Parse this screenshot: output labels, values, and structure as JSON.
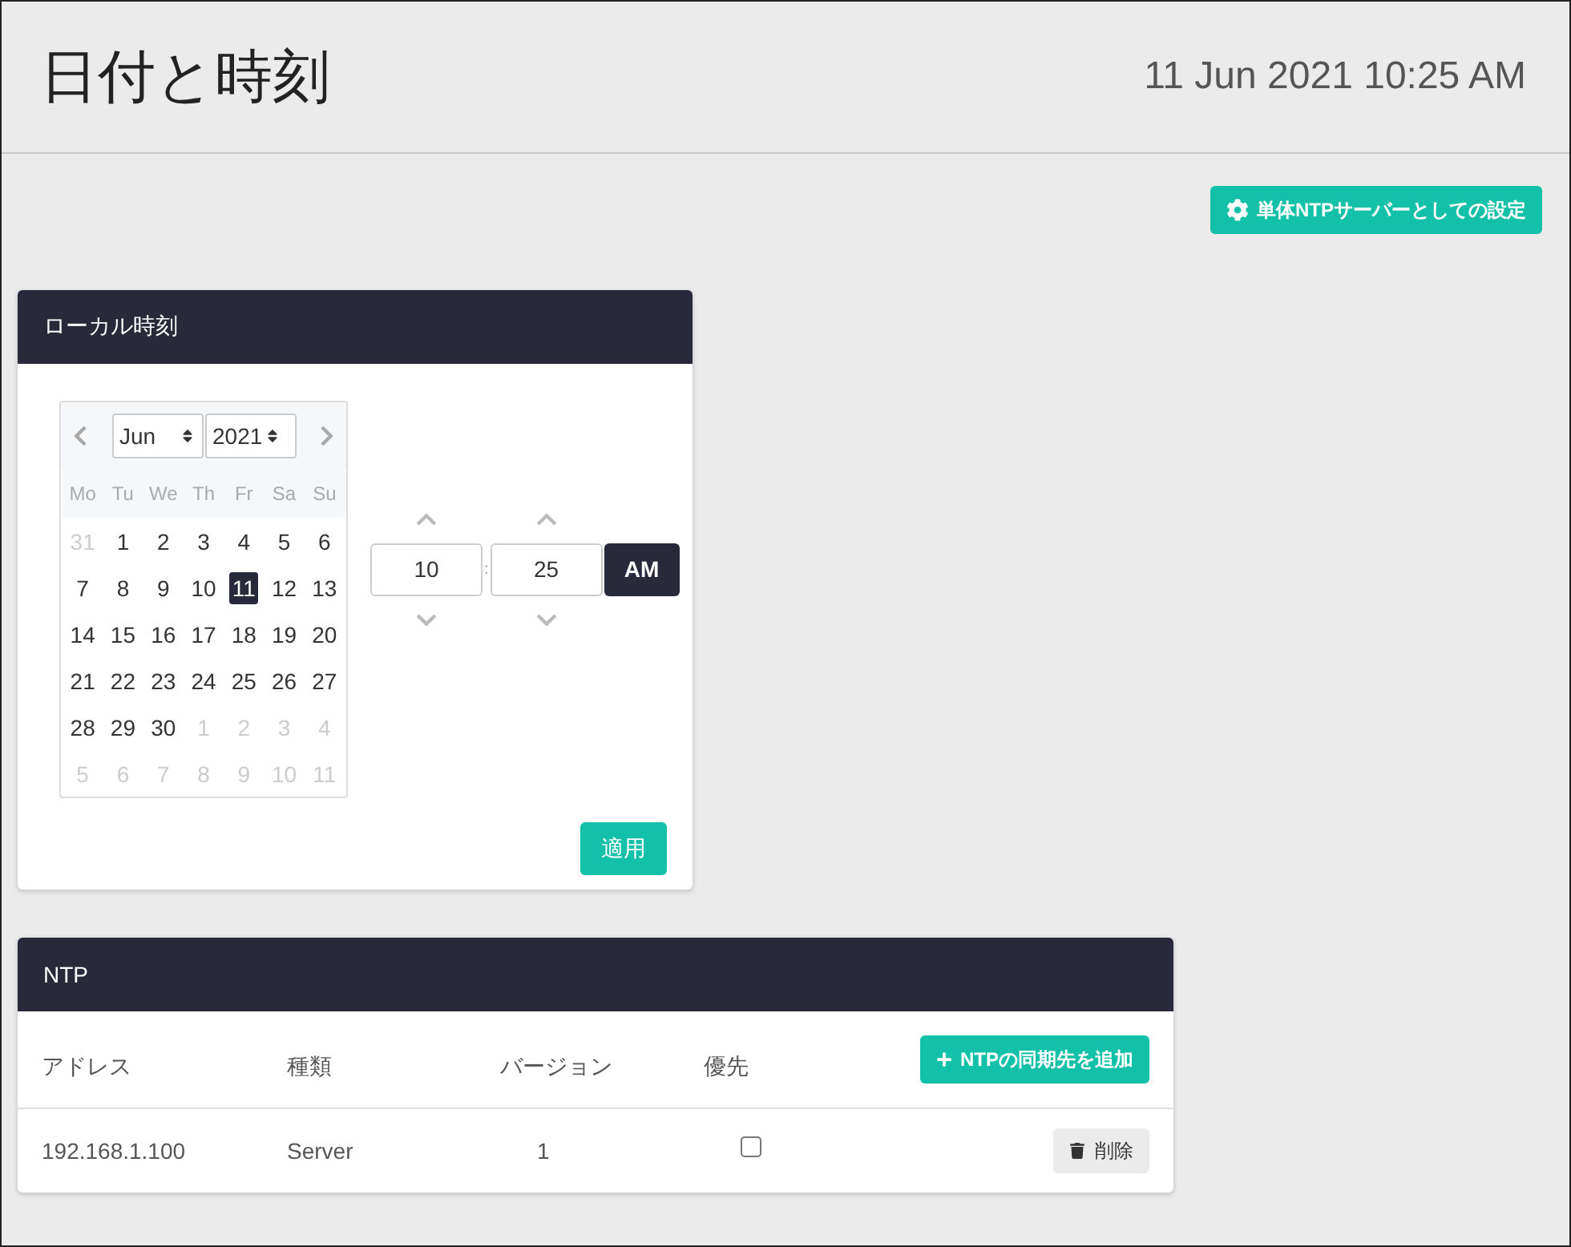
{
  "header": {
    "title": "日付と時刻",
    "datetime": "11 Jun 2021 10:25 AM"
  },
  "standalone_button": {
    "label": "単体NTPサーバーとしての設定"
  },
  "local_time": {
    "title": "ローカル時刻",
    "calendar": {
      "month": "Jun",
      "year": "2021",
      "weekdays": [
        "Mo",
        "Tu",
        "We",
        "Th",
        "Fr",
        "Sa",
        "Su"
      ],
      "weeks": [
        [
          {
            "label": "31",
            "muted": true,
            "selected": false
          },
          {
            "label": "1",
            "muted": false,
            "selected": false
          },
          {
            "label": "2",
            "muted": false,
            "selected": false
          },
          {
            "label": "3",
            "muted": false,
            "selected": false
          },
          {
            "label": "4",
            "muted": false,
            "selected": false
          },
          {
            "label": "5",
            "muted": false,
            "selected": false
          },
          {
            "label": "6",
            "muted": false,
            "selected": false
          }
        ],
        [
          {
            "label": "7",
            "muted": false,
            "selected": false
          },
          {
            "label": "8",
            "muted": false,
            "selected": false
          },
          {
            "label": "9",
            "muted": false,
            "selected": false
          },
          {
            "label": "10",
            "muted": false,
            "selected": false
          },
          {
            "label": "11",
            "muted": false,
            "selected": true
          },
          {
            "label": "12",
            "muted": false,
            "selected": false
          },
          {
            "label": "13",
            "muted": false,
            "selected": false
          }
        ],
        [
          {
            "label": "14",
            "muted": false,
            "selected": false
          },
          {
            "label": "15",
            "muted": false,
            "selected": false
          },
          {
            "label": "16",
            "muted": false,
            "selected": false
          },
          {
            "label": "17",
            "muted": false,
            "selected": false
          },
          {
            "label": "18",
            "muted": false,
            "selected": false
          },
          {
            "label": "19",
            "muted": false,
            "selected": false
          },
          {
            "label": "20",
            "muted": false,
            "selected": false
          }
        ],
        [
          {
            "label": "21",
            "muted": false,
            "selected": false
          },
          {
            "label": "22",
            "muted": false,
            "selected": false
          },
          {
            "label": "23",
            "muted": false,
            "selected": false
          },
          {
            "label": "24",
            "muted": false,
            "selected": false
          },
          {
            "label": "25",
            "muted": false,
            "selected": false
          },
          {
            "label": "26",
            "muted": false,
            "selected": false
          },
          {
            "label": "27",
            "muted": false,
            "selected": false
          }
        ],
        [
          {
            "label": "28",
            "muted": false,
            "selected": false
          },
          {
            "label": "29",
            "muted": false,
            "selected": false
          },
          {
            "label": "30",
            "muted": false,
            "selected": false
          },
          {
            "label": "1",
            "muted": true,
            "selected": false
          },
          {
            "label": "2",
            "muted": true,
            "selected": false
          },
          {
            "label": "3",
            "muted": true,
            "selected": false
          },
          {
            "label": "4",
            "muted": true,
            "selected": false
          }
        ],
        [
          {
            "label": "5",
            "muted": true,
            "selected": false
          },
          {
            "label": "6",
            "muted": true,
            "selected": false
          },
          {
            "label": "7",
            "muted": true,
            "selected": false
          },
          {
            "label": "8",
            "muted": true,
            "selected": false
          },
          {
            "label": "9",
            "muted": true,
            "selected": false
          },
          {
            "label": "10",
            "muted": true,
            "selected": false
          },
          {
            "label": "11",
            "muted": true,
            "selected": false
          }
        ]
      ]
    },
    "time": {
      "hour": "10",
      "separator": ":",
      "minute": "25",
      "meridiem": "AM"
    },
    "apply_button": "適用"
  },
  "ntp": {
    "title": "NTP",
    "columns": [
      "アドレス",
      "種類",
      "バージョン",
      "優先"
    ],
    "add_button": "NTPの同期先を追加",
    "rows": [
      {
        "address": "192.168.1.100",
        "type": "Server",
        "version": "1",
        "preferred": false,
        "delete_button": "削除"
      }
    ]
  }
}
